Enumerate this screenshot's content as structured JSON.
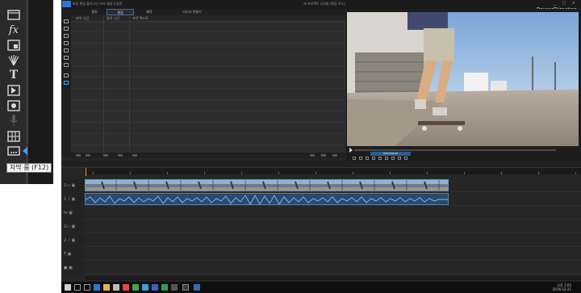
{
  "zoom_panel": {
    "tooltip": "자막 룸 (F12)",
    "icons": [
      "media-room-icon",
      "fx-icon",
      "pip-designer-icon",
      "particle-icon",
      "title-icon",
      "transition-icon",
      "audio-mixing-icon",
      "voiceover-icon",
      "chapter-icon",
      "subtitle-room-icon"
    ],
    "fx_glyph": "fx",
    "title_glyph": "T"
  },
  "app": {
    "brand": "PowerDirector",
    "menu": "파일  편집  플러그인  보기  재생  도움말",
    "window_title": "새 프로젝트 (무제) (편집 모드)",
    "window_controls": "_ □ ×",
    "tabs": [
      "캡처",
      "편집",
      "제작",
      "디스크 만들기"
    ],
    "active_tab": "편집",
    "library_columns": [
      "자막 시간",
      "종료 시간",
      "자막 텍스트"
    ],
    "timecode": "00;00;00;00",
    "zoom_select": "50%"
  },
  "taskbar": {
    "time": "오후 1:05",
    "date": "2016-12-21"
  },
  "colors": {
    "accent": "#2b78d6",
    "playhead": "#ff9b27",
    "clip_border": "#6a93c4",
    "audio_clip": "#2a4a6b"
  }
}
